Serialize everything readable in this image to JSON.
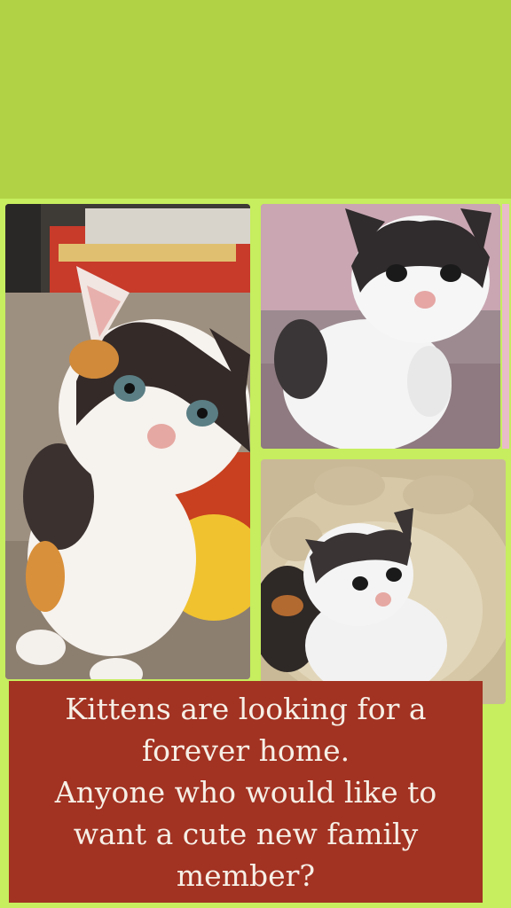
{
  "caption": "Kittens are looking for a\nforever home.\nAnyone who would like to\nwant a cute new family\nmember?",
  "colors": {
    "background": "#b1d244",
    "collage_bg": "#c6ee5e",
    "caption_box": "#a23222",
    "caption_text": "#f6efe6"
  },
  "photos": [
    {
      "subject": "calico-kitten"
    },
    {
      "subject": "black-white-kitten"
    },
    {
      "subject": "kittens-in-bed"
    }
  ]
}
